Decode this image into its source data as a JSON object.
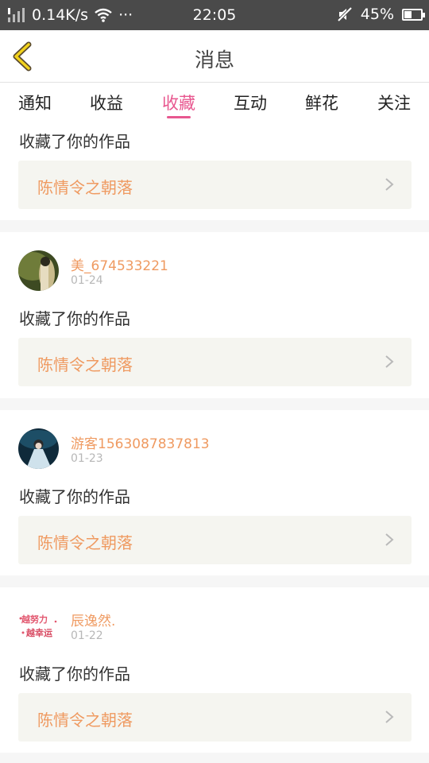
{
  "status_bar": {
    "network_speed": "0.14K/s",
    "dots": "···",
    "time": "22:05",
    "battery": "45%",
    "battery_level": 0.45
  },
  "header": {
    "title": "消息"
  },
  "tabs": [
    {
      "label": "通知"
    },
    {
      "label": "收益"
    },
    {
      "label": "收藏",
      "active": true
    },
    {
      "label": "互动"
    },
    {
      "label": "鲜花"
    },
    {
      "label": "关注"
    }
  ],
  "partial_item": {
    "message": "收藏了你的作品",
    "work_title": "陈情令之朝落"
  },
  "items": [
    {
      "username": "美_674533221",
      "date": "01-24",
      "message": "收藏了你的作品",
      "work_title": "陈情令之朝落"
    },
    {
      "username": "游客1563087837813",
      "date": "01-23",
      "message": "收藏了你的作品",
      "work_title": "陈情令之朝落"
    },
    {
      "username": "辰逸然.",
      "date": "01-22",
      "message": "收藏了你的作品",
      "work_title": "陈情令之朝落",
      "avatar_text": "越努力越幸运"
    }
  ],
  "colors": {
    "accent": "#e8578f",
    "username": "#ef9a61",
    "status_bar": "#4a4a4a",
    "page_bg": "#f6f6f6",
    "work_bg": "#f5f5f0"
  }
}
